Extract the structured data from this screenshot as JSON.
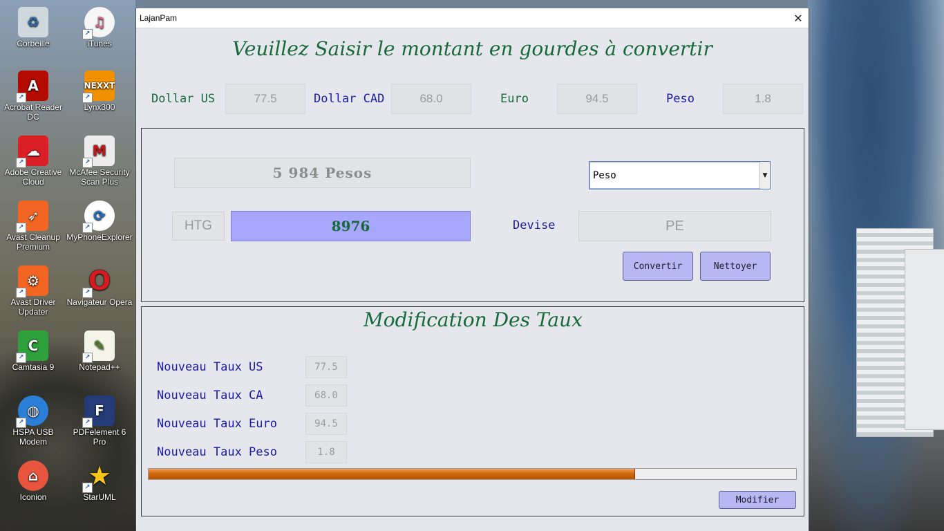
{
  "desktop": {
    "icons": [
      {
        "label": "Corbeille",
        "icon": "recycle-bin-icon",
        "color": "#cfd8dc"
      },
      {
        "label": "iTunes",
        "icon": "itunes-icon",
        "color": "#f25c8a"
      },
      {
        "label": "Acrobat Reader DC",
        "icon": "acrobat-icon",
        "color": "#b30b00"
      },
      {
        "label": "Lynx300",
        "icon": "nexxt-icon",
        "color": "#f29100"
      },
      {
        "label": "Adobe Creative Cloud",
        "icon": "creative-cloud-icon",
        "color": "#da1f26"
      },
      {
        "label": "McAfee Security Scan Plus",
        "icon": "mcafee-icon",
        "color": "#c01818"
      },
      {
        "label": "Avast Cleanup Premium",
        "icon": "rocket-icon",
        "color": "#f26522"
      },
      {
        "label": "MyPhoneExplorer",
        "icon": "sync-icon",
        "color": "#1e73c8"
      },
      {
        "label": "Avast Driver Updater",
        "icon": "driver-icon",
        "color": "#f26522"
      },
      {
        "label": "Navigateur Opera",
        "icon": "opera-icon",
        "color": "#d71920"
      },
      {
        "label": "Camtasia 9",
        "icon": "camtasia-icon",
        "color": "#2ea03c"
      },
      {
        "label": "Notepad++",
        "icon": "notepad-icon",
        "color": "#8dc63f"
      },
      {
        "label": "HSPA USB Modem",
        "icon": "globe-icon",
        "color": "#2b7fd6"
      },
      {
        "label": "PDFelement 6 Pro",
        "icon": "pdfelement-icon",
        "color": "#243b78"
      },
      {
        "label": "Iconion",
        "icon": "home-icon",
        "color": "#e8553e"
      },
      {
        "label": "StarUML",
        "icon": "star-icon",
        "color": "#f5c518"
      }
    ]
  },
  "window": {
    "title": "LajanPam",
    "close_glyph": "✕"
  },
  "header": {
    "title": "Veuillez Saisir le montant en gourdes à convertir"
  },
  "rates": [
    {
      "label": "Dollar US",
      "value": "77.5",
      "color": "#17693a"
    },
    {
      "label": "Dollar CAD",
      "value": "68.0",
      "color": "#1a1aa6"
    },
    {
      "label": "Euro",
      "value": "94.5",
      "color": "#17693a"
    },
    {
      "label": "Peso",
      "value": "1.8",
      "color": "#1a1aa6"
    }
  ],
  "converter": {
    "result_text": "5 984 Pesos",
    "currency_select": {
      "selected": "Peso"
    },
    "source_currency": "HTG",
    "amount": "8976",
    "devise_label": "Devise",
    "devise_code": "PE",
    "convert_button": "Convertir",
    "clear_button": "Nettoyer"
  },
  "modification": {
    "title": "Modification Des Taux",
    "rows": [
      {
        "label": "Nouveau Taux US",
        "value": "77.5"
      },
      {
        "label": "Nouveau Taux CA",
        "value": "68.0"
      },
      {
        "label": "Nouveau Taux Euro",
        "value": "94.5"
      },
      {
        "label": "Nouveau Taux Peso",
        "value": "1.8"
      }
    ],
    "progress_fraction": 0.75,
    "modify_button": "Modifier"
  }
}
